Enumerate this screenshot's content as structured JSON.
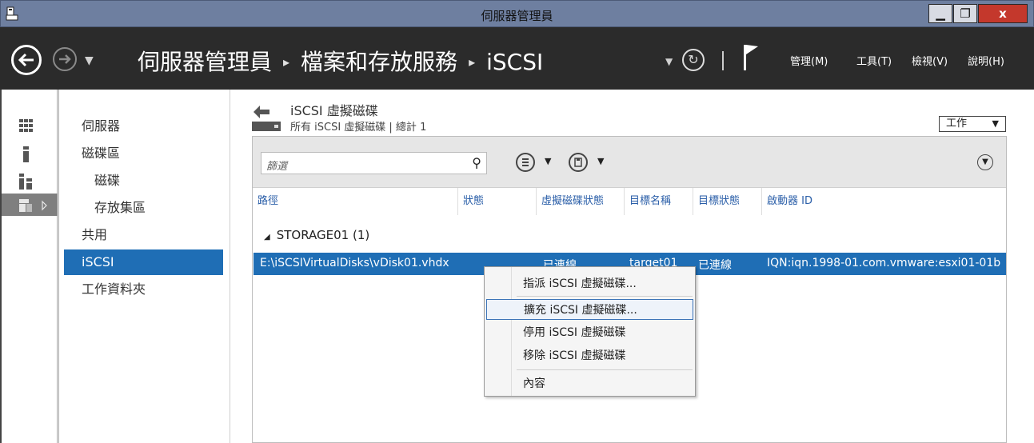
{
  "window": {
    "title": "伺服器管理員",
    "min_glyph": "▁",
    "max_glyph": "❐",
    "close_glyph": "x"
  },
  "header": {
    "breadcrumb": [
      "伺服器管理員",
      "檔案和存放服務",
      "iSCSI"
    ],
    "breadcrumb_sep": "▸",
    "menus": [
      "管理(M)",
      "工具(T)",
      "檢視(V)",
      "說明(H)"
    ]
  },
  "nav": {
    "items": [
      {
        "label": "伺服器"
      },
      {
        "label": "磁碟區"
      },
      {
        "label": "磁碟"
      },
      {
        "label": "存放集區"
      },
      {
        "label": "共用"
      },
      {
        "label": "iSCSI"
      },
      {
        "label": "工作資料夾"
      }
    ]
  },
  "section": {
    "title": "iSCSI 虛擬磁碟",
    "subtitle": "所有 iSCSI 虛擬磁碟 | 總計 1",
    "tasks_label": "工作",
    "filter_placeholder": "篩選"
  },
  "table": {
    "columns": [
      "路徑",
      "狀態",
      "虛擬磁碟狀態",
      "目標名稱",
      "目標狀態",
      "啟動器 ID"
    ],
    "group": {
      "label": "STORAGE01 (1)"
    },
    "rows": [
      {
        "path": "E:\\iSCSIVirtualDisks\\vDisk01.vhdx",
        "vdisk_status": "已連線",
        "target": "target01",
        "target_status": "已連線",
        "initiator": "IQN:iqn.1998-01.com.vmware:esxi01-01b"
      }
    ]
  },
  "context_menu": {
    "items": [
      {
        "label": "指派 iSCSI 虛擬磁碟..."
      },
      {
        "label": "擴充 iSCSI 虛擬磁碟..."
      },
      {
        "label": "停用 iSCSI 虛擬磁碟"
      },
      {
        "label": "移除 iSCSI 虛擬磁碟"
      },
      {
        "label": "內容"
      }
    ]
  },
  "colors": {
    "accent": "#1f6eb5",
    "header_bg": "#2b2b2b",
    "titlebar_bg": "#6e7fa0",
    "close_red": "#c4382c"
  }
}
